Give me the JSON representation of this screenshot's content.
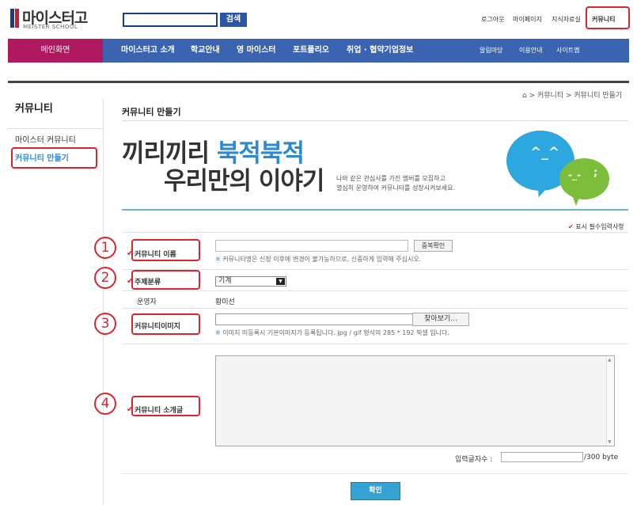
{
  "logo": {
    "name": "마이스터고",
    "sub": "MEISTER SCHOOL"
  },
  "search": {
    "button": "검색"
  },
  "util_links": [
    "로그아웃",
    "마이페이지",
    "지식자료실",
    "커뮤니티"
  ],
  "nav": {
    "home": "메인화면",
    "items": [
      "마이스터고 소개",
      "학교안내",
      "영 마이스터",
      "포트폴리오",
      "취업 · 협약기업정보"
    ],
    "small": [
      "알림마당",
      "이용안내",
      "사이트맵"
    ]
  },
  "sidebar": {
    "title": "커뮤니티",
    "items": [
      "마이스터 커뮤니티",
      "커뮤니티 만들기"
    ]
  },
  "breadcrumb": "> 커뮤니티 > 커뮤니티 만들기",
  "page_title": "커뮤니티 만들기",
  "hero": {
    "line1_a": "끼리끼리",
    "line1_b": "북적북적",
    "line2": "우리만의 이야기",
    "desc1": "나와 같은 관심사를 가진 멤버를 모집하고",
    "desc2": "열심히 운영하여 커뮤니티를 성장시켜보세요."
  },
  "required_note": "표시 필수입력사항",
  "form": {
    "name_label": "커뮤니티 이름",
    "dup_check": "중복확인",
    "name_note": "커뮤니티명은 신청 이후에 변경이 불가능하므로, 신중하게 입력해 주십시오.",
    "category_label": "주제분류",
    "category_value": "기계",
    "owner_label": "운영자",
    "owner_value": "황미선",
    "image_label": "커뮤니티이미지",
    "browse": "찾아보기...",
    "image_note": "이미지 미등록시 기본이미지가 등록됩니다. jpg / gif 형식의 285 * 192 픽셀 입니다.",
    "intro_label": "커뮤니티 소개글",
    "count_label": "입력글자수 :",
    "count_total": "/300 byte",
    "confirm": "확인"
  },
  "markers": [
    "1",
    "2",
    "3",
    "4"
  ],
  "faces": {
    "blue": "^_^",
    "green_eyes": "-_-",
    "green_mark": ";"
  },
  "colors": {
    "nav": "#3a64b0",
    "home": "#b0185f",
    "highlight": "#d9252f",
    "accent": "#2e8ad0"
  }
}
